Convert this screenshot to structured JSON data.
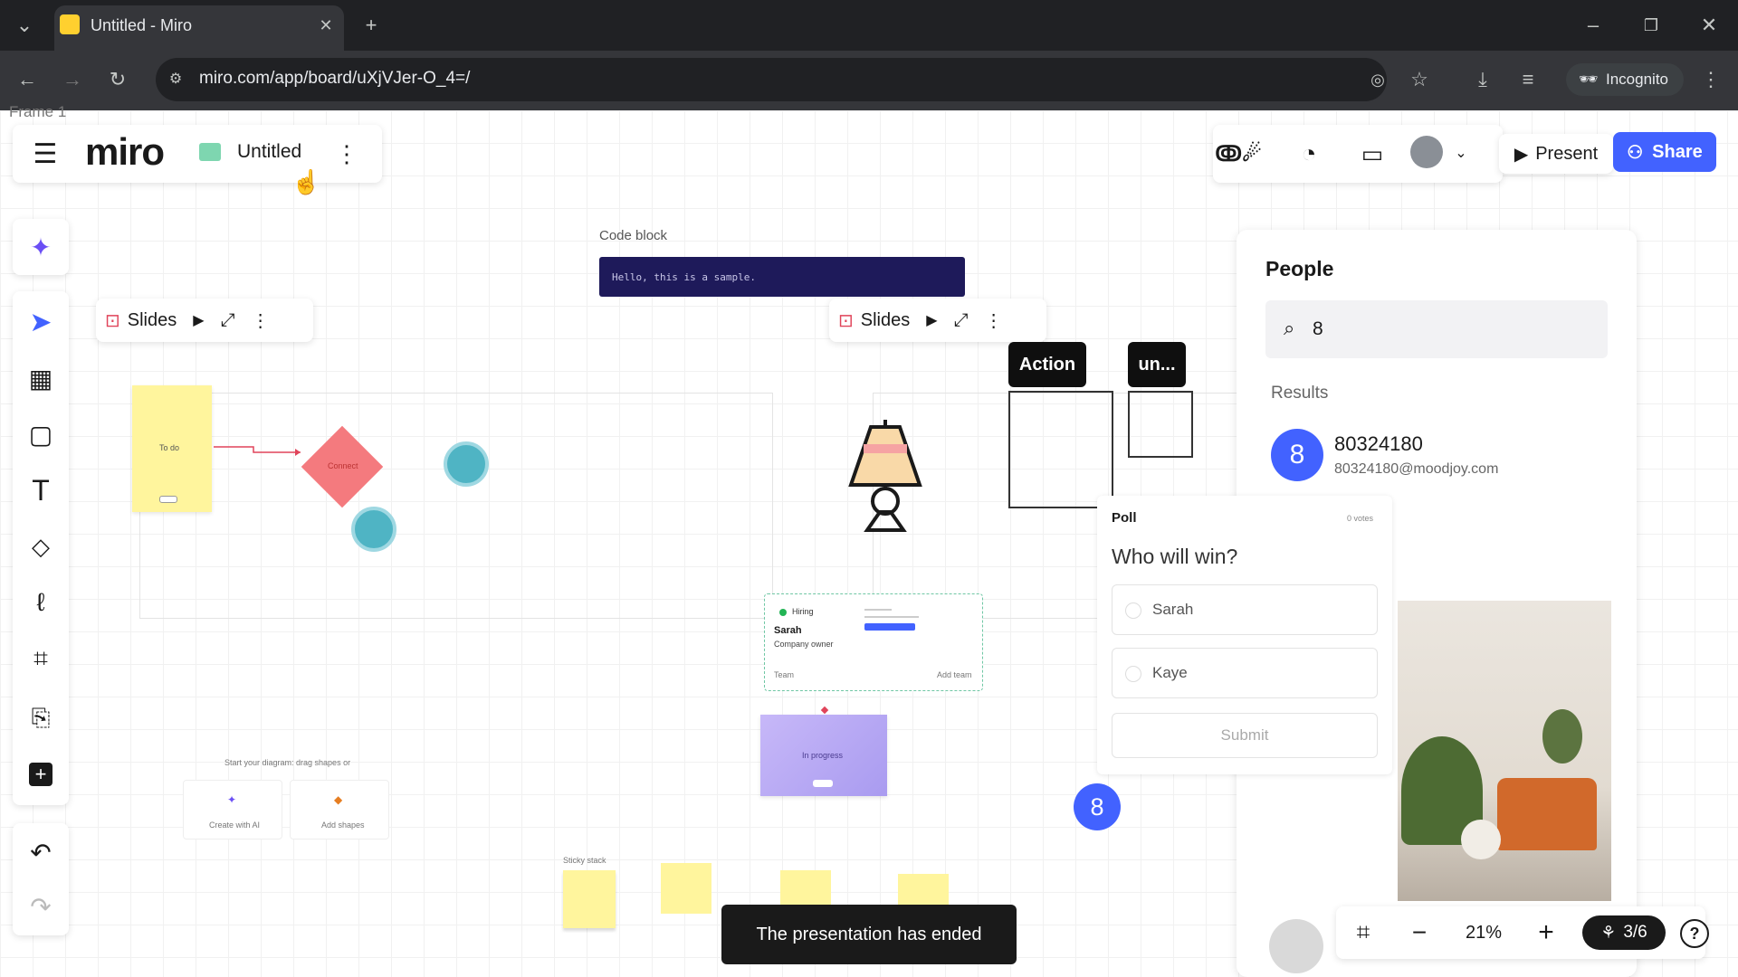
{
  "browser": {
    "tab_title": "Untitled - Miro",
    "url": "miro.com/app/board/uXjVJer-O_4=/",
    "incognito_label": "Incognito"
  },
  "canvas": {
    "frame_label": "Frame 1"
  },
  "topbar": {
    "logo": "miro",
    "board_title": "Untitled",
    "present_label": "Present",
    "share_label": "Share"
  },
  "slides_toolbar": {
    "label": "Slides"
  },
  "code_block": {
    "label": "Code block",
    "code": "Hello, this is a sample."
  },
  "flow": {
    "todo": "To do",
    "connect": "Connect"
  },
  "tags": {
    "action": "Action",
    "un": "un..."
  },
  "hiring_card": {
    "status": "Hiring",
    "name": "Sarah",
    "role": "Company owner",
    "team": "Team",
    "add_team": "Add team"
  },
  "in_progress": "In progress",
  "diagram_start": {
    "hint": "Start your diagram: drag shapes or",
    "create_ai": "Create with AI",
    "add_shapes": "Add shapes"
  },
  "sticky_stack_label": "Sticky stack",
  "people_panel": {
    "title": "People",
    "search_value": "8",
    "results_label": "Results",
    "result": {
      "initial": "8",
      "name": "80324180",
      "email": "80324180@moodjoy.com"
    }
  },
  "poll": {
    "label": "Poll",
    "votes": "0 votes",
    "question": "Who will win?",
    "options": [
      "Sarah",
      "Kaye"
    ],
    "submit": "Submit"
  },
  "cursor_badge": "8",
  "zoom": {
    "level": "21%",
    "pages": "3/6"
  },
  "toast": "The presentation has ended",
  "colors": {
    "accent": "#4262ff",
    "sticky": "#fff59d",
    "diamond": "#f47a7e",
    "purple": "#b9a8f3"
  }
}
